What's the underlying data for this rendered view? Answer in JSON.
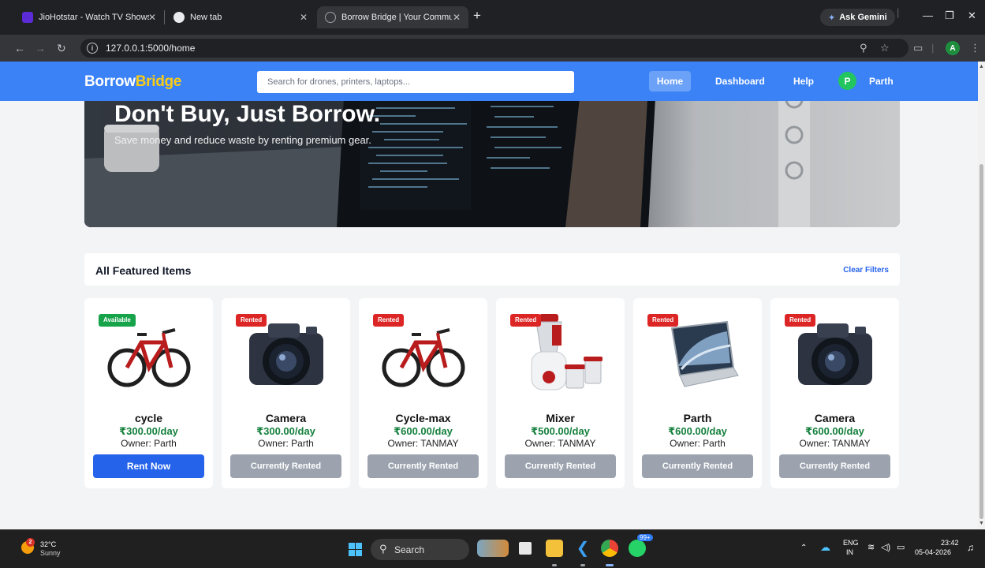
{
  "browser": {
    "tabs": [
      {
        "title": "JioHotstar - Watch TV Shows, M",
        "favicon_color": "#5b2bd6"
      },
      {
        "title": "New tab",
        "favicon_color": "#e8eaed"
      },
      {
        "title": "Borrow Bridge | Your Communi",
        "favicon_color": "#9aa0a6",
        "active": true
      }
    ],
    "ask_gemini": "Ask Gemini",
    "url": "127.0.0.1:5000/home",
    "profile_initial": "A"
  },
  "app": {
    "logo_part1": "Borrow",
    "logo_part2": "Bridge",
    "search_placeholder": "Search for drones, printers, laptops...",
    "nav": {
      "home": "Home",
      "dashboard": "Dashboard",
      "help": "Help"
    },
    "user": {
      "initial": "P",
      "name": "Parth"
    },
    "hero": {
      "title": "Don't Buy, Just Borrow.",
      "subtitle": "Save money and reduce waste by renting premium gear."
    },
    "featured": {
      "title": "All Featured Items",
      "clear_filters": "Clear Filters"
    },
    "items": [
      {
        "status": "Available",
        "name": "cycle",
        "price": "₹300.00/day",
        "owner": "Owner: Parth",
        "button": "Rent Now",
        "image": "bicycle-icon"
      },
      {
        "status": "Rented",
        "name": "Camera",
        "price": "₹300.00/day",
        "owner": "Owner: Parth",
        "button": "Currently Rented",
        "image": "camera-icon"
      },
      {
        "status": "Rented",
        "name": "Cycle-max",
        "price": "₹600.00/day",
        "owner": "Owner: TANMAY",
        "button": "Currently Rented",
        "image": "bicycle-icon"
      },
      {
        "status": "Rented",
        "name": "Mixer",
        "price": "₹500.00/day",
        "owner": "Owner: TANMAY",
        "button": "Currently Rented",
        "image": "mixer-icon"
      },
      {
        "status": "Rented",
        "name": "Parth",
        "price": "₹600.00/day",
        "owner": "Owner: Parth",
        "button": "Currently Rented",
        "image": "laptop-icon"
      },
      {
        "status": "Rented",
        "name": "Camera",
        "price": "₹600.00/day",
        "owner": "Owner: TANMAY",
        "button": "Currently Rented",
        "image": "camera-icon"
      }
    ],
    "colors": {
      "nav_bg": "#3b82f6",
      "logo_accent": "#facc15",
      "price": "#15803d",
      "available": "#16a34a",
      "rented": "#dc2626",
      "rent_button": "#2563eb",
      "disabled_button": "#9ca3af"
    }
  },
  "taskbar": {
    "weather_temp": "32°C",
    "weather_desc": "Sunny",
    "weather_badge": "2",
    "search_label": "Search",
    "whatsapp_badge": "99+",
    "lang_line1": "ENG",
    "lang_line2": "IN",
    "time": "23:42",
    "date": "05-04-2026"
  }
}
